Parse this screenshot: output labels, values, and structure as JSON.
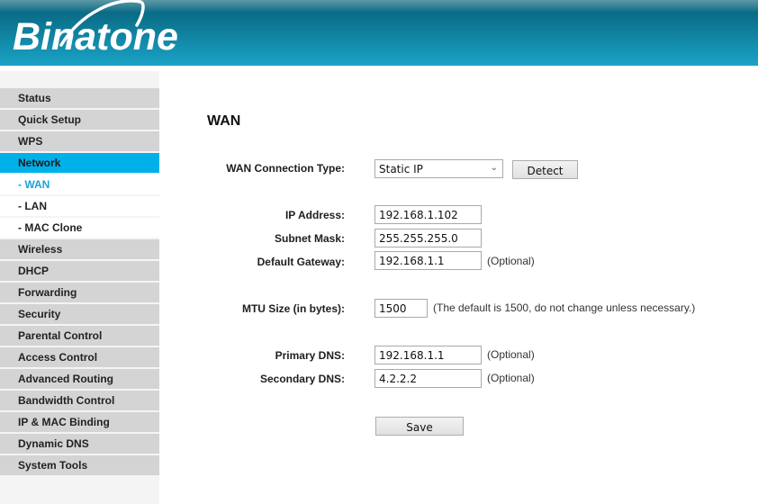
{
  "header": {
    "brand": "Binatone"
  },
  "sidebar": {
    "items": [
      {
        "label": "Status"
      },
      {
        "label": "Quick Setup"
      },
      {
        "label": "WPS"
      },
      {
        "label": "Network"
      },
      {
        "label": "- WAN"
      },
      {
        "label": "- LAN"
      },
      {
        "label": "- MAC Clone"
      },
      {
        "label": "Wireless"
      },
      {
        "label": "DHCP"
      },
      {
        "label": "Forwarding"
      },
      {
        "label": "Security"
      },
      {
        "label": "Parental Control"
      },
      {
        "label": "Access Control"
      },
      {
        "label": "Advanced Routing"
      },
      {
        "label": "Bandwidth Control"
      },
      {
        "label": "IP & MAC Binding"
      },
      {
        "label": "Dynamic DNS"
      },
      {
        "label": "System Tools"
      }
    ],
    "active_section": "Network",
    "active_page": "- WAN"
  },
  "main": {
    "title": "WAN",
    "connection_type": {
      "label": "WAN Connection Type:",
      "value": "Static IP",
      "detect_label": "Detect"
    },
    "ip_address": {
      "label": "IP Address:",
      "value": "192.168.1.102"
    },
    "subnet_mask": {
      "label": "Subnet Mask:",
      "value": "255.255.255.0"
    },
    "default_gateway": {
      "label": "Default Gateway:",
      "value": "192.168.1.1",
      "hint": "(Optional)"
    },
    "mtu": {
      "label": "MTU Size (in bytes):",
      "value": "1500",
      "hint": "(The default is 1500, do not change unless necessary.)"
    },
    "primary_dns": {
      "label": "Primary DNS:",
      "value": "192.168.1.1",
      "hint": "(Optional)"
    },
    "secondary_dns": {
      "label": "Secondary DNS:",
      "value": "4.2.2.2",
      "hint": "(Optional)"
    },
    "save_label": "Save"
  },
  "colors": {
    "header_top": "#0a6b86",
    "header_bottom": "#1ba3c6",
    "menu_active": "#00b0e8",
    "menu_sub_current": "#1aa3d8",
    "menu_bg": "#d4d4d4"
  }
}
